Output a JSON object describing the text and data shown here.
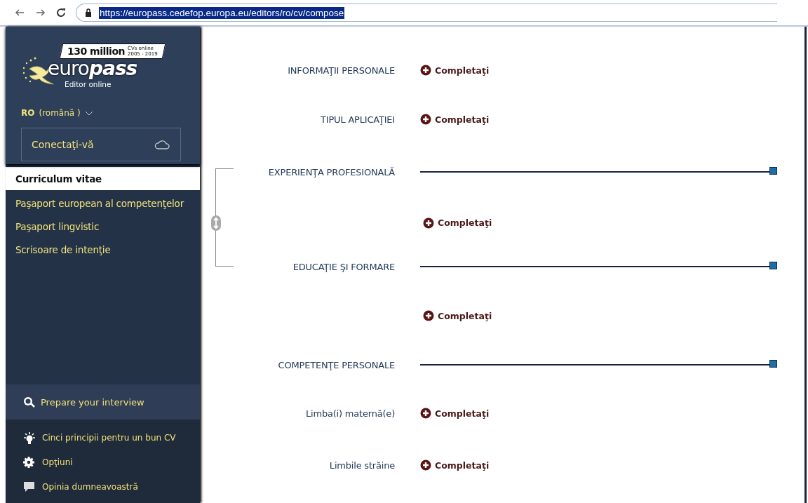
{
  "browser": {
    "url": "https://europass.cedefop.europa.eu/editors/ro/cv/compose",
    "url_selected": true
  },
  "sidebar": {
    "logo": {
      "badge": "130 million",
      "badge_note_1": "CVs online",
      "badge_note_2": "2005 - 2019",
      "wordmark_1": "euro",
      "wordmark_2": "pass",
      "subtitle": "Editor online"
    },
    "language": {
      "code": "RO",
      "name": "(română )"
    },
    "login": "Conectaţi-vă",
    "nav": [
      {
        "label": "Curriculum vitae",
        "selected": true
      },
      {
        "label": "Paşaport european al competenţelor",
        "selected": false
      },
      {
        "label": "Paşaport lingvistic",
        "selected": false
      },
      {
        "label": "Scrisoare de intenţie",
        "selected": false
      }
    ],
    "interview": "Prepare your interview",
    "footer": [
      {
        "kind": "bulb",
        "label": "Cinci principii pentru un bun CV"
      },
      {
        "kind": "gear",
        "label": "Opţiuni"
      },
      {
        "kind": "speech",
        "label": "Opinia dumneavoastră"
      }
    ]
  },
  "sections": [
    {
      "kind": "field",
      "label": "INFORMAŢII PERSONALE",
      "action": "Completaţi",
      "bracketed": false
    },
    {
      "kind": "field",
      "label": "TIPUL APLICAŢIEI",
      "action": "Completaţi",
      "bracketed": false
    },
    {
      "kind": "heading",
      "label": "EXPERIENŢA PROFESIONALĂ",
      "bracketed": true
    },
    {
      "kind": "add",
      "action": "Completaţi",
      "bracketed": true
    },
    {
      "kind": "heading",
      "label": "EDUCAŢIE ŞI FORMARE",
      "bracketed": true
    },
    {
      "kind": "add",
      "action": "Completaţi",
      "bracketed": false
    },
    {
      "kind": "heading",
      "label": "COMPETENŢE PERSONALE",
      "bracketed": false
    },
    {
      "kind": "field",
      "label": "Limba(i) maternă(e)",
      "action": "Completaţi",
      "bracketed": false
    },
    {
      "kind": "field",
      "label": "Limbile străine",
      "action": "Completaţi",
      "bracketed": false
    }
  ]
}
